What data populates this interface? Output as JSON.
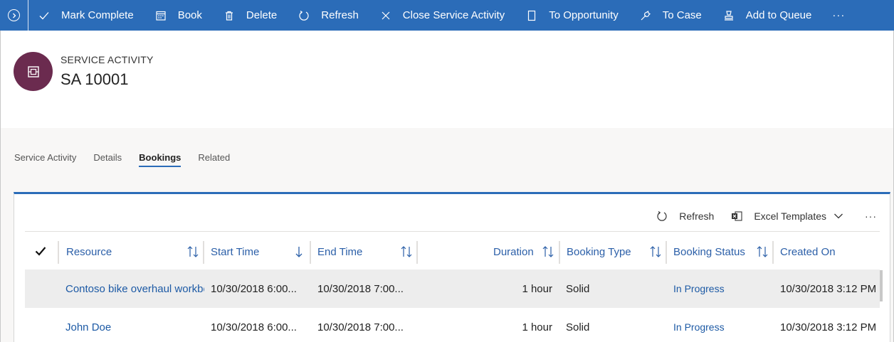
{
  "command_bar": {
    "items": [
      {
        "label": "Mark Complete",
        "icon": "checkmark-icon"
      },
      {
        "label": "Book",
        "icon": "calendar-icon"
      },
      {
        "label": "Delete",
        "icon": "trash-icon"
      },
      {
        "label": "Refresh",
        "icon": "refresh-icon"
      },
      {
        "label": "Close Service Activity",
        "icon": "close-icon"
      },
      {
        "label": "To Opportunity",
        "icon": "document-icon"
      },
      {
        "label": "To Case",
        "icon": "wrench-icon"
      },
      {
        "label": "Add to Queue",
        "icon": "queue-icon"
      }
    ],
    "more": "···",
    "accent": "#2b6cb8"
  },
  "header": {
    "entity_type": "SERVICE ACTIVITY",
    "record_name": "SA 10001",
    "avatar_color": "#6b2b4f"
  },
  "tabs": [
    "Service Activity",
    "Details",
    "Bookings",
    "Related"
  ],
  "active_tab": "Bookings",
  "grid_toolbar": {
    "refresh_label": "Refresh",
    "excel_label": "Excel Templates",
    "more": "···"
  },
  "grid": {
    "columns": [
      "Resource",
      "Start Time",
      "End Time",
      "Duration",
      "Booking Type",
      "Booking Status",
      "Created On"
    ],
    "rows": [
      {
        "resource": "Contoso bike overhaul workbench",
        "start_time": "10/30/2018 6:00...",
        "end_time": "10/30/2018 7:00...",
        "duration": "1 hour",
        "booking_type": "Solid",
        "booking_status": "In Progress",
        "created_on": "10/30/2018 3:12 PM"
      },
      {
        "resource": "John Doe",
        "start_time": "10/30/2018 6:00...",
        "end_time": "10/30/2018 7:00...",
        "duration": "1 hour",
        "booking_type": "Solid",
        "booking_status": "In Progress",
        "created_on": "10/30/2018 3:12 PM"
      }
    ]
  }
}
